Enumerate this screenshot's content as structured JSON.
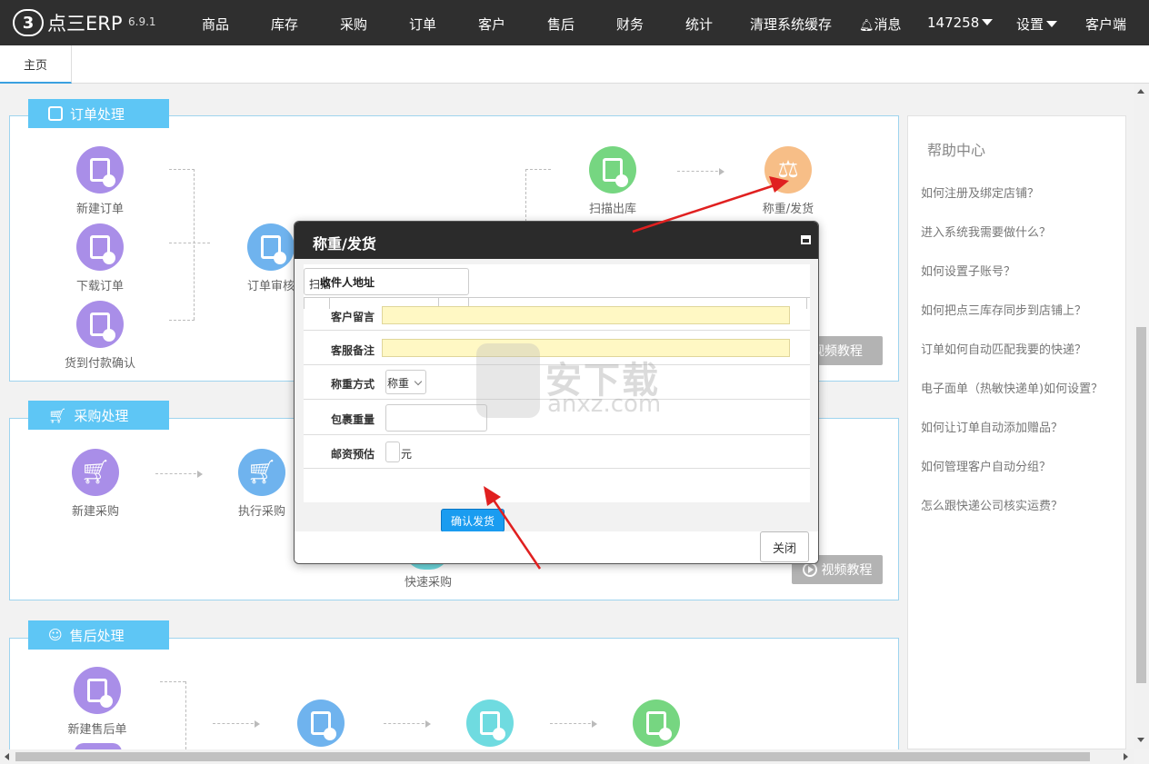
{
  "app": {
    "logo_mark": "3",
    "logo_text": "点三ERP",
    "version": "6.9.1"
  },
  "nav": {
    "items": [
      "商品",
      "库存",
      "采购",
      "订单",
      "客户",
      "售后",
      "财务",
      "统计",
      "清理系统缓存"
    ],
    "messages": "消息",
    "user": "147258",
    "settings": "设置",
    "client": "客户端"
  },
  "tabs": {
    "home": "主页"
  },
  "sections": {
    "order": {
      "title": "订单处理",
      "nodes": [
        "新建订单",
        "下载订单",
        "货到付款确认",
        "订单审核",
        "扫描出库",
        "称重/发货"
      ],
      "video": "视频教程"
    },
    "purchase": {
      "title": "采购处理",
      "nodes": [
        "新建采购",
        "执行采购",
        "快速采购"
      ],
      "video": "视频教程"
    },
    "aftersale": {
      "title": "售后处理",
      "nodes": [
        "新建售后单"
      ]
    }
  },
  "help": {
    "title": "帮助中心",
    "links": [
      "如何注册及绑定店铺？",
      "进入系统我需要做什么？",
      "如何设置子账号？",
      "如何把点三库存同步到店铺上？",
      "订单如何自动匹配我要的快递？",
      "电子面单（热敏快递单)如何设置？",
      "如何让订单自动添加赠品？",
      "如何管理客户自动分组？",
      "怎么跟快递公司核实运费？"
    ]
  },
  "modal": {
    "title": "称重/发货",
    "overlap_text_1": "扫描",
    "overlap_text_2": "收件人地址",
    "fields": {
      "customer_note": "客户留言",
      "service_note": "客服备注",
      "weigh_mode": "称重方式",
      "weigh_mode_value": "称重",
      "package_weight": "包裹重量",
      "postage_estimate": "邮资预估",
      "postage_unit": "元"
    },
    "confirm": "确认发货",
    "close": "关闭"
  },
  "watermark": {
    "cn": "安下载",
    "en": "anxz.com"
  },
  "colors": {
    "nav_bg": "#2f2f2f",
    "section_header": "#5ec6f5",
    "confirm_button": "#1a9cf0",
    "annotation_arrow": "#e02020"
  }
}
